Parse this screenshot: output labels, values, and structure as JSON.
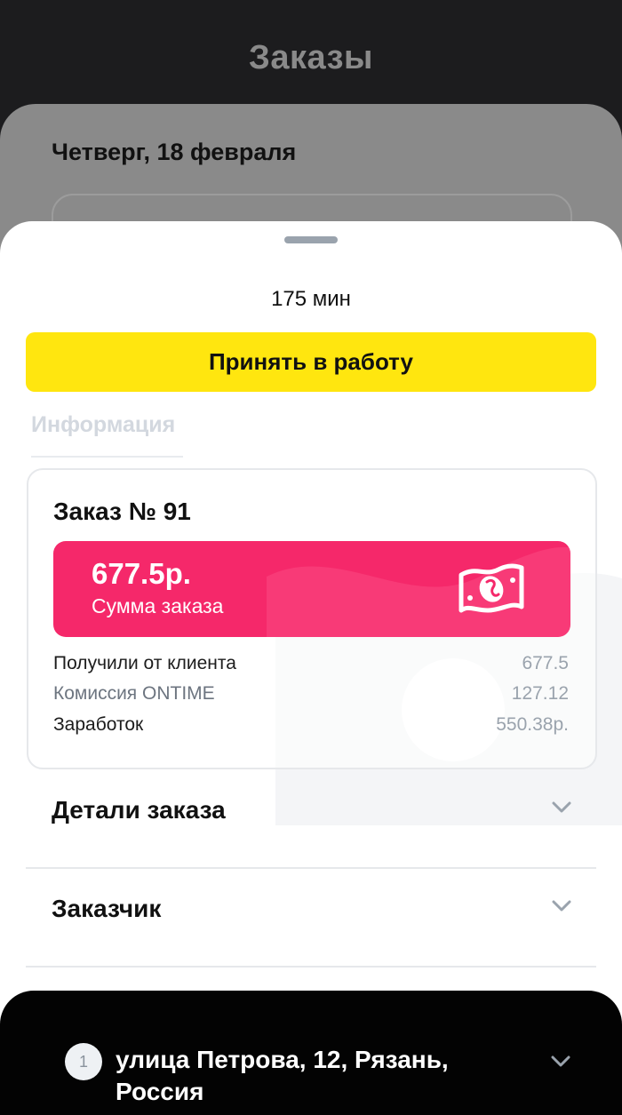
{
  "header": {
    "title": "Заказы"
  },
  "background": {
    "date": "Четверг, 18 февраля"
  },
  "sheet": {
    "timer": "175 мин",
    "accept_button": "Принять в работу",
    "tab_info": "Информация"
  },
  "order": {
    "title": "Заказ № 91",
    "sum_value": "677.5р.",
    "sum_label": "Сумма заказа",
    "rows": [
      {
        "label": "Получили от клиента",
        "value": "677.5"
      },
      {
        "label": "Комиссия ONTIME",
        "value": "127.12"
      },
      {
        "label": "Заработок",
        "value": "550.38р."
      }
    ]
  },
  "accordions": [
    {
      "label": "Детали заказа"
    },
    {
      "label": "Заказчик"
    }
  ],
  "route": {
    "stop_number": "1",
    "address": "улица Петрова, 12, Рязань, Россия"
  },
  "colors": {
    "accent_yellow": "#ffe60f",
    "sum_pink": "#f5286a",
    "sheet_bg": "#ffffff",
    "dim_bg": "#8a8a8a"
  },
  "icons": {
    "money": "money-bill-icon",
    "chevron": "chevron-down-icon"
  }
}
